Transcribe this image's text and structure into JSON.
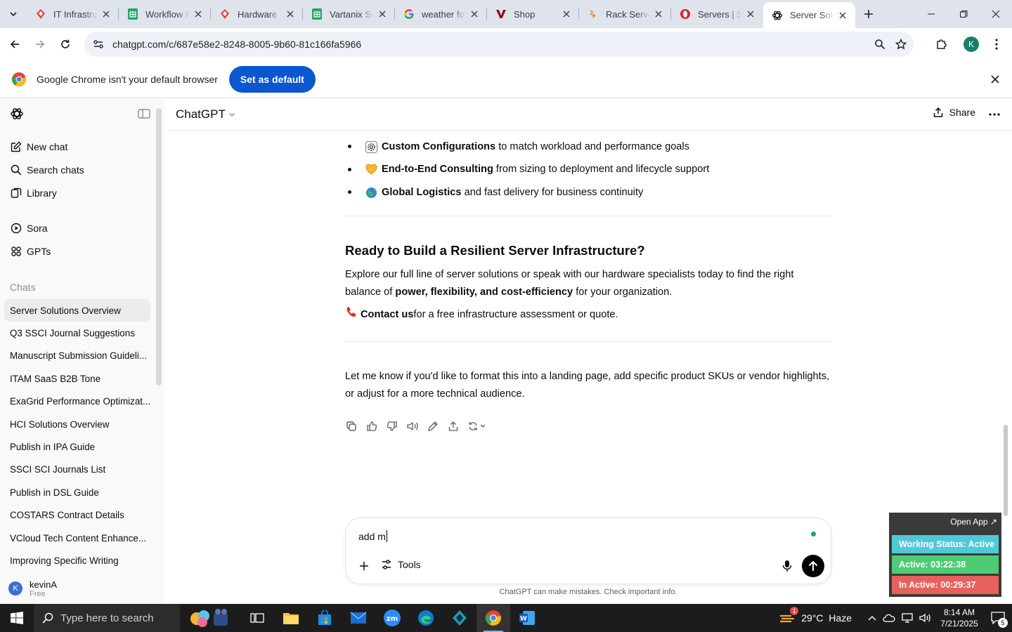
{
  "browser": {
    "tabs": [
      {
        "title": "IT Infrastructure",
        "icon": "red-diamond-icon"
      },
      {
        "title": "Workflow Freedom",
        "icon": "green-sheets-icon"
      },
      {
        "title": "Hardware - Vartanix",
        "icon": "red-diamond-icon"
      },
      {
        "title": "Vartanix Servers",
        "icon": "green-sheets-icon"
      },
      {
        "title": "weather for",
        "icon": "google-g-icon"
      },
      {
        "title": "Shop",
        "icon": "v-logo-icon"
      },
      {
        "title": "Rack Servers",
        "icon": "orange-logo-icon"
      },
      {
        "title": "Servers | Shop",
        "icon": "opera-red-icon"
      },
      {
        "title": "Server Solutions",
        "icon": "chatgpt-icon"
      }
    ],
    "url": "chatgpt.com/c/687e58e2-8248-8005-9b60-81c166fa5966",
    "profile_initial": "K",
    "infobar": {
      "message": "Google Chrome isn't your default browser",
      "button": "Set as default"
    }
  },
  "sidebar": {
    "nav": [
      {
        "label": "New chat",
        "icon": "new-chat-icon"
      },
      {
        "label": "Search chats",
        "icon": "search-icon"
      },
      {
        "label": "Library",
        "icon": "library-icon"
      }
    ],
    "nav2": [
      {
        "label": "Sora",
        "icon": "sora-icon"
      },
      {
        "label": "GPTs",
        "icon": "gpts-grid-icon"
      }
    ],
    "chats_label": "Chats",
    "chats": [
      "Server Solutions Overview",
      "Q3 SSCI Journal Suggestions",
      "Manuscript Submission Guideli...",
      "ITAM SaaS B2B Tone",
      "ExaGrid Performance Optimizat...",
      "HCI Solutions Overview",
      "Publish in IPA Guide",
      "SSCI SCI Journals List",
      "Publish in DSL Guide",
      "COSTARS Contract Details",
      "VCloud Tech Content Enhance...",
      "Improving Specific Writing"
    ],
    "user": {
      "initial": "K",
      "name": "kevinA",
      "plan": "Free"
    }
  },
  "main": {
    "model": "ChatGPT",
    "share": "Share",
    "features": [
      {
        "bold": "Custom Configurations",
        "rest": " to match workload and performance goals"
      },
      {
        "bold": "End-to-End Consulting",
        "rest": " from sizing to deployment and lifecycle support"
      },
      {
        "bold": "Global Logistics",
        "rest": " and fast delivery for business continuity"
      }
    ],
    "cta_heading": "Ready to Build a Resilient Server Infrastructure?",
    "cta_body_1": "Explore our full line of server solutions or speak with our hardware specialists today to find the right balance of ",
    "cta_body_bold": "power, flexibility, and cost-efficiency",
    "cta_body_2": " for your organization.",
    "contact_bold": "Contact us",
    "contact_rest": " for a free infrastructure assessment or quote.",
    "closing": "Let me know if you'd like to format this into a landing page, add specific product SKUs or vendor highlights, or adjust for a more technical audience.",
    "composer_text": "add m",
    "tools": "Tools",
    "disclaimer": "ChatGPT can make mistakes. Check important info."
  },
  "widget": {
    "open_app": "Open App ↗",
    "working_status": "Working Status: Active",
    "active": "Active: 03:22:38",
    "inactive": "In Active: 00:29:37",
    "colors": {
      "status": "#4fc9d8",
      "active": "#4ecb73",
      "inactive": "#e8605c"
    }
  },
  "taskbar": {
    "search_placeholder": "Type here to search",
    "weather": "29°C  Haze",
    "weather_badge": "1",
    "time": "8:14 AM",
    "date": "7/21/2025",
    "notifications": "5"
  }
}
